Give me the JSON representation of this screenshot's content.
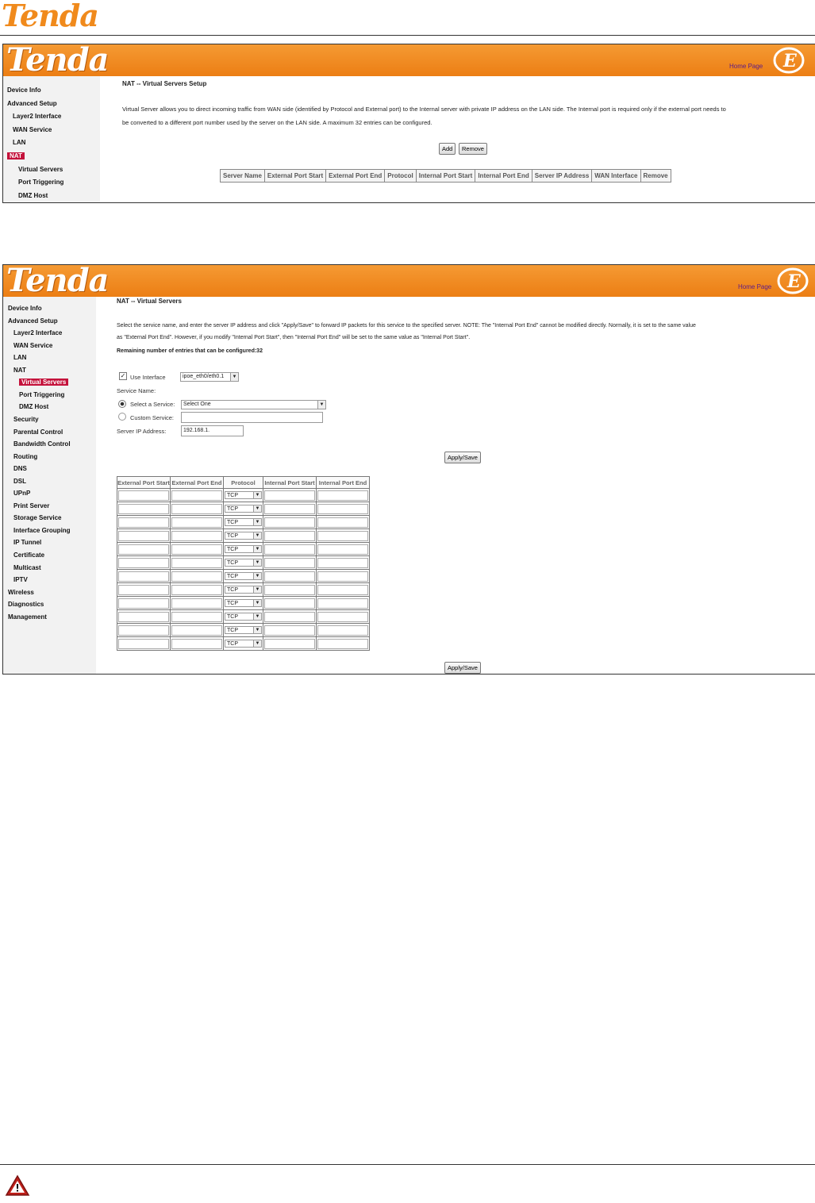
{
  "document": {
    "logo_text": "Tenda"
  },
  "screenshot1": {
    "logo": "Tenda",
    "home_link": "Home Page",
    "nav": [
      "Device Info",
      "Advanced Setup",
      "Layer2 Interface",
      "WAN Service",
      "LAN",
      "NAT",
      "Virtual Servers",
      "Port Triggering",
      "DMZ Host"
    ],
    "active_nav": "NAT",
    "heading": "NAT -- Virtual Servers Setup",
    "description_line1": "Virtual Server allows you to direct incoming traffic from WAN side (identified by Protocol and External port) to the Internal server with private IP address on the LAN side. The Internal port is required only if the external port needs to",
    "description_line2": "be converted to a different port number used by the server on the LAN side. A maximum 32 entries can be configured.",
    "buttons": {
      "add": "Add",
      "remove": "Remove"
    },
    "table_headers": [
      "Server Name",
      "External Port Start",
      "External Port End",
      "Protocol",
      "Internal Port Start",
      "Internal Port End",
      "Server IP Address",
      "WAN Interface",
      "Remove"
    ]
  },
  "screenshot2": {
    "logo": "Tenda",
    "home_link": "Home Page",
    "nav": [
      "Device Info",
      "Advanced Setup",
      "Layer2 Interface",
      "WAN Service",
      "LAN",
      "NAT",
      "Virtual Servers",
      "Port Triggering",
      "DMZ Host",
      "Security",
      "Parental Control",
      "Bandwidth Control",
      "Routing",
      "DNS",
      "DSL",
      "UPnP",
      "Print Server",
      "Storage Service",
      "Interface Grouping",
      "IP Tunnel",
      "Certificate",
      "Multicast",
      "IPTV",
      "Wireless",
      "Diagnostics",
      "Management"
    ],
    "active_nav": "Virtual Servers",
    "heading": "NAT -- Virtual Servers",
    "instructions_line1": "Select the service name, and enter the server IP address and click \"Apply/Save\" to forward IP packets for this service to the specified server. NOTE: The \"Internal Port End\" cannot be modified directly. Normally, it is set to the same value",
    "instructions_line2": "as \"External Port End\". However, if you modify \"Internal Port Start\", then \"Internal Port End\" will be set to the same value as \"Internal Port Start\".",
    "remaining": "Remaining number of entries that can be configured:32",
    "use_interface_label": "Use Interface",
    "use_interface_checked": true,
    "interface_value": "ipoe_eth0/eth0.1",
    "service_name_label": "Service Name:",
    "select_service_label": "Select a Service:",
    "select_service_value": "Select One",
    "custom_service_label": "Custom Service:",
    "server_ip_label": "Server IP Address:",
    "server_ip_value": "192.168.1.",
    "apply_label": "Apply/Save",
    "port_headers": [
      "External Port Start",
      "External Port End",
      "Protocol",
      "Internal Port Start",
      "Internal Port End"
    ],
    "protocol_default": "TCP",
    "row_count": 12
  }
}
